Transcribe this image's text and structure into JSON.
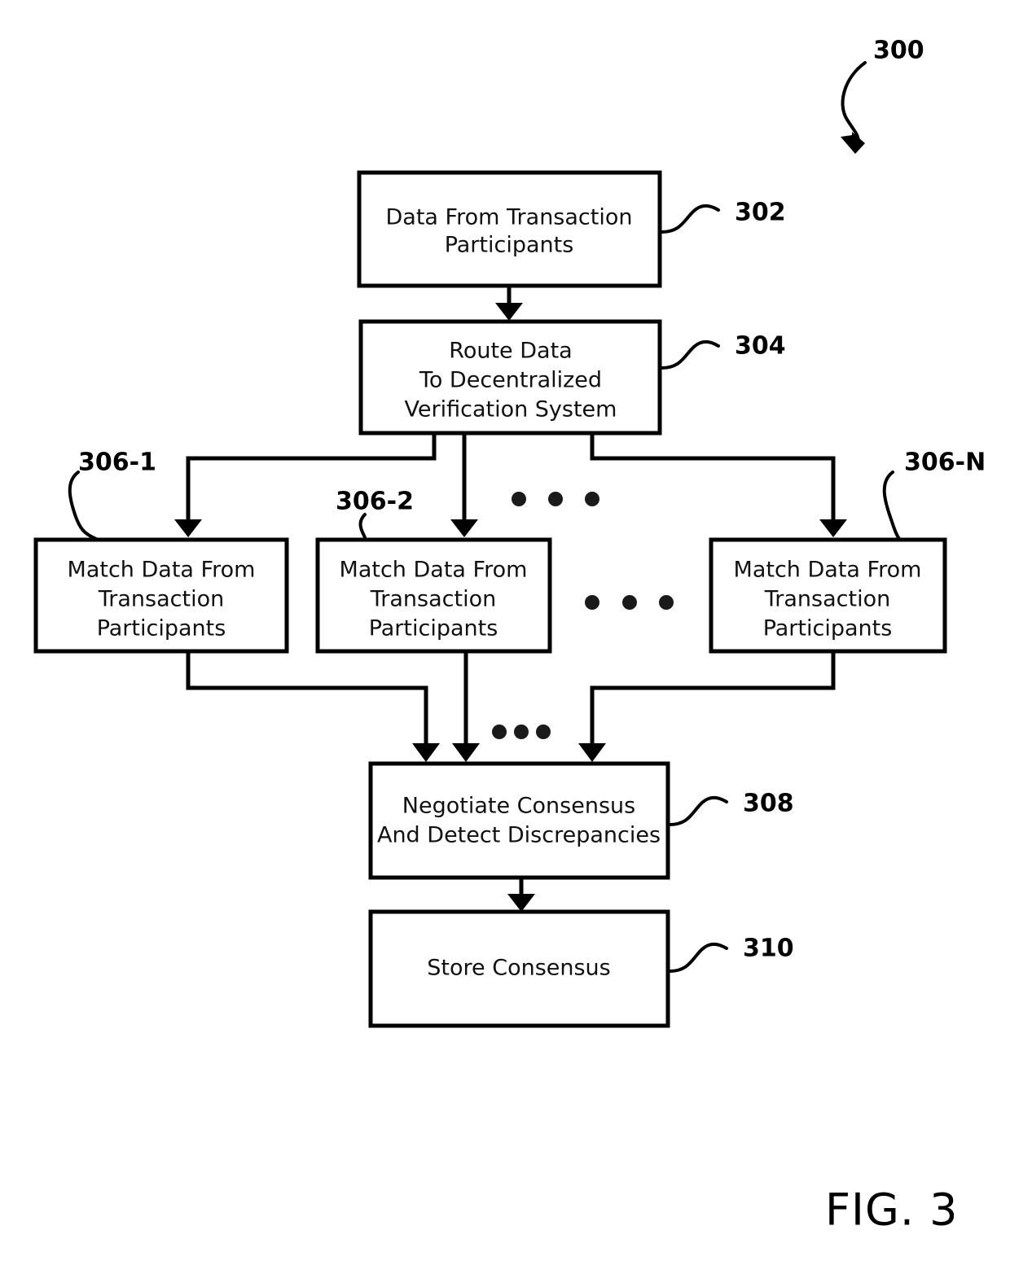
{
  "figure": {
    "caption": "FIG. 3",
    "diagram_ref": "300"
  },
  "nodes": [
    {
      "id": "302",
      "ref": "302",
      "lines": [
        "Data From Transaction",
        "Participants"
      ]
    },
    {
      "id": "304",
      "ref": "304",
      "lines": [
        "Route Data",
        "To Decentralized",
        "Verification System"
      ]
    },
    {
      "id": "306-1",
      "ref": "306-1",
      "lines": [
        "Match Data From",
        "Transaction",
        "Participants"
      ]
    },
    {
      "id": "306-2",
      "ref": "306-2",
      "lines": [
        "Match Data From",
        "Transaction",
        "Participants"
      ]
    },
    {
      "id": "306-N",
      "ref": "306-N",
      "lines": [
        "Match Data From",
        "Transaction",
        "Participants"
      ]
    },
    {
      "id": "308",
      "ref": "308",
      "lines": [
        "Negotiate Consensus",
        "And Detect Discrepancies"
      ]
    },
    {
      "id": "310",
      "ref": "310",
      "lines": [
        "Store Consensus"
      ]
    }
  ],
  "ellipses": [
    {
      "name": "ellipsis-top",
      "glyph": "• • •"
    },
    {
      "name": "ellipsis-middle",
      "glyph": "• • •"
    },
    {
      "name": "ellipsis-bottom",
      "glyph": "• • •"
    }
  ],
  "colors": {
    "stroke": "#000000",
    "text": "#111111",
    "background": "#ffffff"
  }
}
